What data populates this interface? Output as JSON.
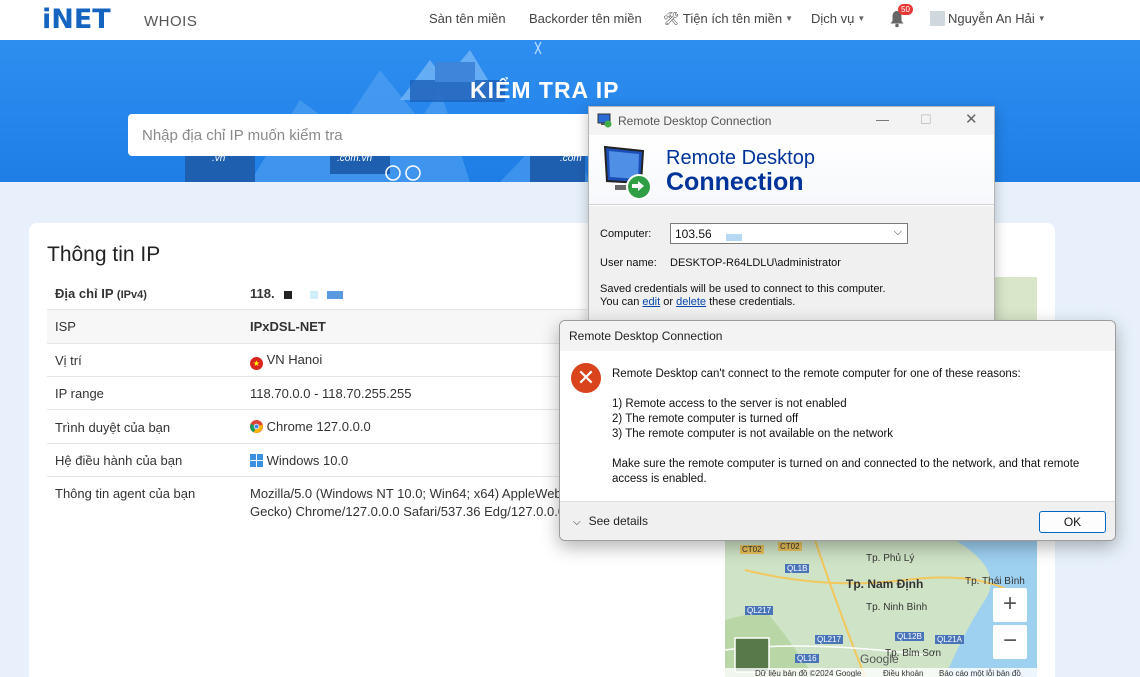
{
  "nav": {
    "logo": "iNET",
    "logo_sub": "WHOIS",
    "items": [
      "Sàn tên miền",
      "Backorder tên miền",
      "Tiện ích tên miền",
      "Dịch vụ"
    ],
    "notification_count": "50",
    "user": "Nguyễn An Hải"
  },
  "banner": {
    "title": "KIỂM TRA IP",
    "search_placeholder": "Nhập địa chỉ IP muốn kiểm tra",
    "domain_tags": [
      ".vn",
      ".com.vn",
      ".com"
    ]
  },
  "info": {
    "title": "Thông tin IP",
    "rows": [
      {
        "key": "Địa chỉ IP",
        "key_sub": "(IPv4)",
        "value": "118."
      },
      {
        "key": "ISP",
        "value": "IPxDSL-NET"
      },
      {
        "key": "Vị trí",
        "value": "VN Hanoi"
      },
      {
        "key": "IP range",
        "value": "118.70.0.0 - 118.70.255.255"
      },
      {
        "key": "Trình duyệt của bạn",
        "value": "Chrome 127.0.0.0"
      },
      {
        "key": "Hệ điều hành của bạn",
        "value": "Windows 10.0"
      },
      {
        "key": "Thông tin agent của bạn",
        "value": "Mozilla/5.0 (Windows NT 10.0; Win64; x64) AppleWebKi",
        "value2": "Gecko) Chrome/127.0.0.0 Safari/537.36 Edg/127.0.0.0"
      }
    ]
  },
  "map": {
    "places": [
      "Tp. Phủ Lý",
      "Tp. Nam Định",
      "Tp. Thái Bình",
      "Tp. Ninh Bình",
      "Tp. Bỉm Sơn"
    ],
    "roads": [
      "CT02",
      "CT02",
      "QL1B",
      "QL217",
      "QL217",
      "QL12B",
      "QL21A",
      "QL16"
    ],
    "footer": "Dữ liệu bản đồ ©2024 Google",
    "terms": "Điều khoản",
    "report": "Báo cáo một lỗi bản đồ",
    "google": "Google"
  },
  "rdc": {
    "title": "Remote Desktop Connection",
    "header_line1": "Remote Desktop",
    "header_line2": "Connection",
    "computer_label": "Computer:",
    "computer_value": "103.56.",
    "username_label": "User name:",
    "username_value": "DESKTOP-R64LDLU\\administrator",
    "cred_line1": "Saved credentials will be used to connect to this computer.",
    "cred_pre": "You can ",
    "cred_edit": "edit",
    "cred_or": " or ",
    "cred_delete": "delete",
    "cred_post": " these credentials."
  },
  "error": {
    "title": "Remote Desktop Connection",
    "message": "Remote Desktop can't connect to the remote computer for one of these reasons:",
    "reason1": "1) Remote access to the server is not enabled",
    "reason2": "2) The remote computer is turned off",
    "reason3": "3) The remote computer is not available on the network",
    "advice1": "Make sure the remote computer is turned on and connected to the network, and that remote",
    "advice2": "access is enabled.",
    "see_details": "See details",
    "ok": "OK"
  }
}
